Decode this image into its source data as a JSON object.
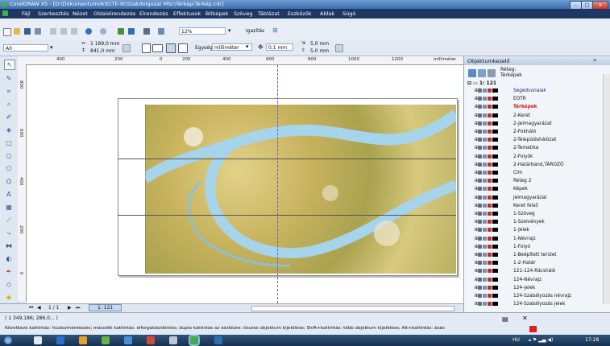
{
  "window": {
    "title": "CorelDRAW X5 - [D:\\Dokumentumok\\ELTE-IK\\Szakdolgozat MSc\\Térkép\\Térkép.cdr]",
    "min": "–",
    "max": "□",
    "close": "×"
  },
  "menu": [
    "Fájl",
    "Szerkesztés",
    "Nézet",
    "Oldalelrendezés",
    "Elrendezés",
    "Effektusok",
    "Bitképek",
    "Szöveg",
    "Táblázat",
    "Eszközök",
    "Ablak",
    "Súgó"
  ],
  "toolbar": {
    "zoom": "12%",
    "align_label": "Igazítás",
    "preset": "A0",
    "width": "1 189,0 mm",
    "height": "841,0 mm",
    "units_label": "Egység:",
    "units": "milliméter",
    "nudge": "0,1 mm",
    "dup_x": "5,0 mm",
    "dup_y": "5,0 mm"
  },
  "ruler": {
    "h_ticks": [
      "400",
      "200",
      "0",
      "200",
      "400",
      "600",
      "800",
      "1000",
      "1200"
    ],
    "unit": "milliméter",
    "v_ticks": [
      "800",
      "600",
      "400",
      "200",
      "0"
    ]
  },
  "pagenav": {
    "page_count": "1 / 1",
    "page_tab": "1: 121"
  },
  "status": {
    "coords": "( 1 349,186; 286,0... )",
    "hint": "Következő kattintás: húzás/méretezés; második kattintás: elforgatás/döntés; dupla kattintás az eszközre: összes objektum kijelölése; Shift+kattintás: több objektum kijelölése; Alt+kattintás: ásás"
  },
  "docker": {
    "title": "Objektumkezelő",
    "layer_label": "Réteg:",
    "layer_value": "Térképek",
    "page_node": "1: 121",
    "layers": [
      {
        "name": "Segédvonalak",
        "style": "italic",
        "color": "#1a2a7a"
      },
      {
        "name": "EOTR",
        "style": "normal",
        "color": "#111"
      },
      {
        "name": "Térképek",
        "style": "bold",
        "color": "#d21a1a"
      },
      {
        "name": "2-Keret",
        "style": "normal",
        "color": "#111"
      },
      {
        "name": "2-Jelmagyarázat",
        "style": "normal",
        "color": "#111"
      },
      {
        "name": "2-Fokháló",
        "style": "normal",
        "color": "#111"
      },
      {
        "name": "2-Településhálózat",
        "style": "normal",
        "color": "#111"
      },
      {
        "name": "2-Tematika",
        "style": "normal",
        "color": "#111"
      },
      {
        "name": "2-Folyók",
        "style": "normal",
        "color": "#111"
      },
      {
        "name": "2-Határband,TÁROZÓ",
        "style": "normal",
        "color": "#111"
      },
      {
        "name": "Cím",
        "style": "normal",
        "color": "#111"
      },
      {
        "name": "Réteg 2",
        "style": "normal",
        "color": "#111"
      },
      {
        "name": "Képek",
        "style": "normal",
        "color": "#111"
      },
      {
        "name": "Jelmagyarázat",
        "style": "normal",
        "color": "#111"
      },
      {
        "name": "Keret felső",
        "style": "normal",
        "color": "#111"
      },
      {
        "name": "1-Szöveg",
        "style": "normal",
        "color": "#111"
      },
      {
        "name": "1-Szelvények",
        "style": "normal",
        "color": "#111"
      },
      {
        "name": "1-Jelek",
        "style": "normal",
        "color": "#111"
      },
      {
        "name": "1-Névrajz",
        "style": "normal",
        "color": "#111"
      },
      {
        "name": "1-Folyó",
        "style": "normal",
        "color": "#111"
      },
      {
        "name": "1-Beépített terület",
        "style": "normal",
        "color": "#111"
      },
      {
        "name": "1-2-Határ",
        "style": "normal",
        "color": "#111"
      },
      {
        "name": "121-124-Rácsháló",
        "style": "normal",
        "color": "#111"
      },
      {
        "name": "124-Névrajz",
        "style": "normal",
        "color": "#111"
      },
      {
        "name": "124-Jelek",
        "style": "normal",
        "color": "#111"
      },
      {
        "name": "124-Szabályozás névrajz",
        "style": "normal",
        "color": "#111"
      },
      {
        "name": "124-Szabályozás jelek",
        "style": "normal",
        "color": "#111"
      }
    ]
  },
  "taskbar": {
    "lang": "HU",
    "time": "17:28"
  },
  "colors": {
    "menubar": "#1e3763",
    "active_layer": "#d21a1a",
    "river": "#a6d4ea",
    "guide": "#6d5ed6"
  }
}
